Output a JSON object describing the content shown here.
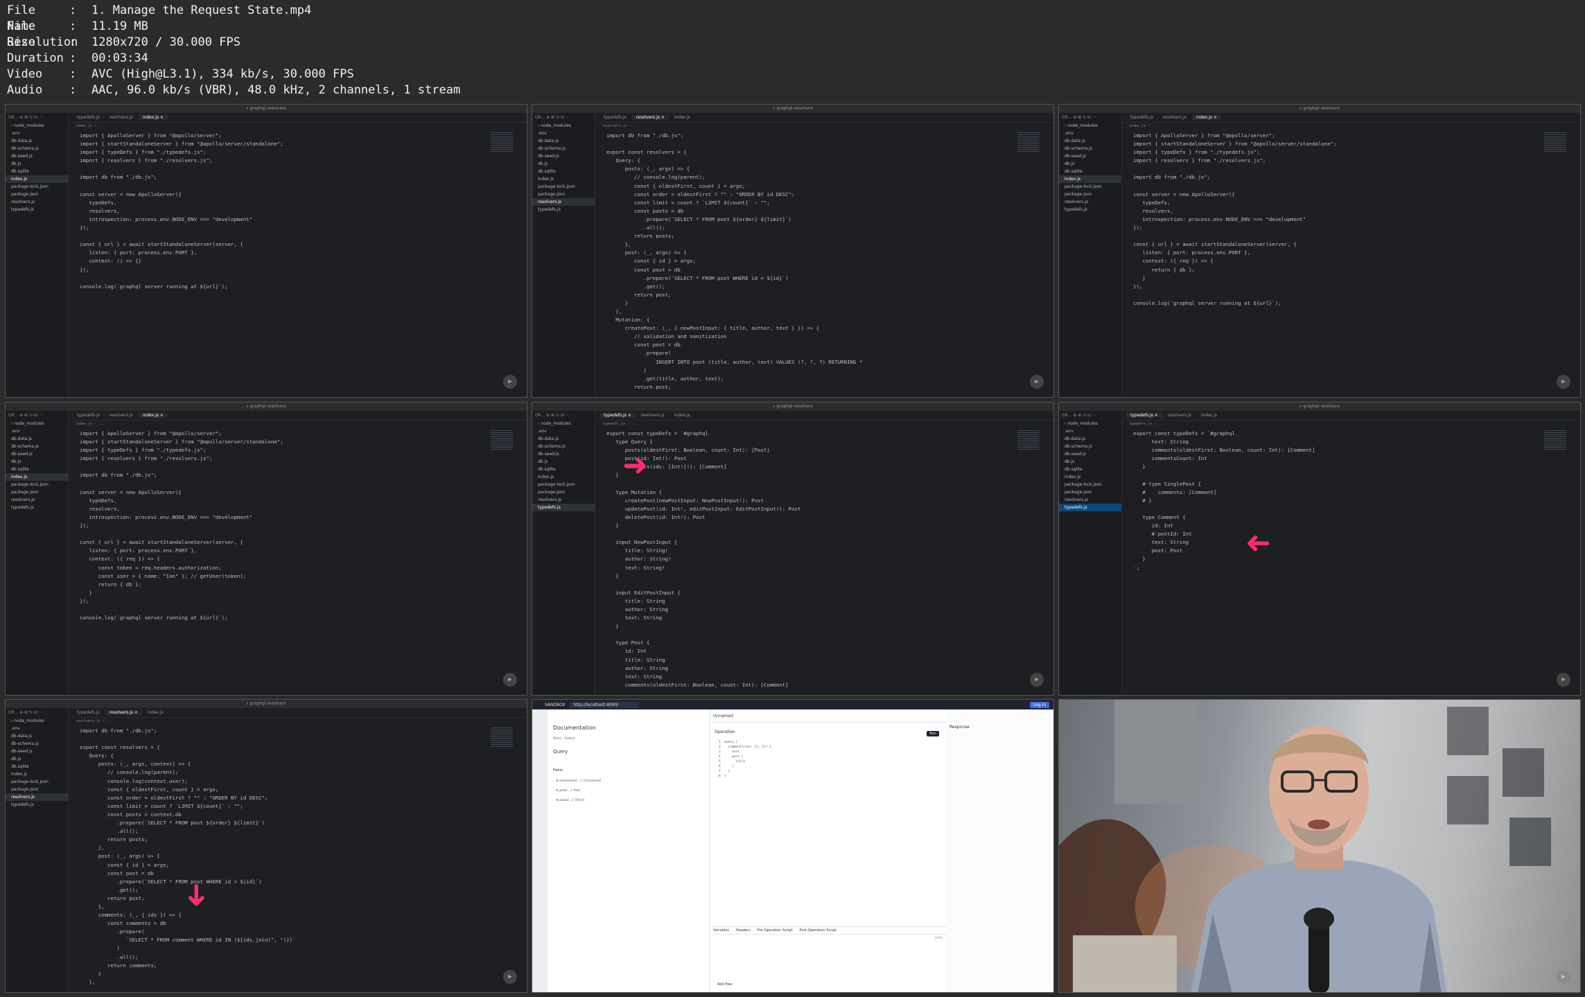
{
  "meta": [
    {
      "key": "File Name",
      "value": "1. Manage the Request State.mp4"
    },
    {
      "key": "File Size",
      "value": "11.19 MB"
    },
    {
      "key": "Resolution",
      "value": "1280x720 / 30.000 FPS"
    },
    {
      "key": "Duration",
      "value": "00:03:34"
    },
    {
      "key": "Video",
      "value": "AVC (High@L3.1), 334 kb/s, 30.000 FPS"
    },
    {
      "key": "Audio",
      "value": "AAC, 96.0 kb/s (VBR), 48.0 kHz, 2 channels, 1 stream"
    }
  ],
  "ide": {
    "window_title": "graphql-resolvers",
    "files": [
      "node_modules",
      ".env",
      "db-data.js",
      "db-schema.js",
      "db-seed.js",
      "db.js",
      "db.sqlite",
      "index.js",
      "package-lock.json",
      "package.json",
      "resolvers.js",
      "typedefs.js"
    ],
    "tabs": [
      "typedefs.js",
      "resolvers.js",
      "index.js"
    ]
  },
  "frames": [
    {
      "active_file": "index.js",
      "code": "import { ApolloServer } from \"@apollo/server\";\nimport { startStandaloneServer } from \"@apollo/server/standalone\";\nimport { typeDefs } from \"./typedefs.js\";\nimport { resolvers } from \"./resolvers.js\";\n\nimport db from \"./db.js\";\n\nconst server = new ApolloServer({\n   typeDefs,\n   resolvers,\n   introspection: process.env.NODE_ENV === \"development\"\n});\n\nconst { url } = await startStandaloneServer(server, {\n   listen: { port: process.env.PORT },\n   context: () => {}\n});\n\nconsole.log(`graphql server running at ${url}`);"
    },
    {
      "active_file": "resolvers.js",
      "code": "import db from \"./db.js\";\n\nexport const resolvers = {\n   Query: {\n      posts: (_, args) => {\n         // console.log(parent);\n         const { oldestFirst, count } = args;\n         const order = oldestFirst ? \"\" : \"ORDER BY id DESC\";\n         const limit = count ? `LIMIT ${count}` : \"\";\n         const posts = db\n            .prepare(`SELECT * FROM post ${order} ${limit}`)\n            .all();\n         return posts;\n      },\n      post: (_, args) => {\n         const { id } = args;\n         const post = db\n            .prepare(`SELECT * FROM post WHERE id = ${id}`)\n            .get();\n         return post;\n      }\n   },\n   Mutation: {\n      createPost: (_, { newPostInput: { title, author, text } }) => {\n         // validation and sanitization\n         const post = db\n            .prepare(\n               `INSERT INTO post (title, author, text) VALUES (?, ?, ?) RETURNING *`\n            )\n            .get(title, author, text);\n         return post;"
    },
    {
      "active_file": "index.js",
      "code": "import { ApolloServer } from \"@apollo/server\";\nimport { startStandaloneServer } from \"@apollo/server/standalone\";\nimport { typeDefs } from \"./typedefs.js\";\nimport { resolvers } from \"./resolvers.js\";\n\nimport db from \"./db.js\";\n\nconst server = new ApolloServer({\n   typeDefs,\n   resolvers,\n   introspection: process.env.NODE_ENV === \"development\"\n});\n\nconst { url } = await startStandaloneServer(server, {\n   listen: { port: process.env.PORT },\n   context: ({ req }) => {\n      return { db };\n   }\n});\n\nconsole.log(`graphql server running at ${url}`);"
    },
    {
      "active_file": "index.js",
      "code": "import { ApolloServer } from \"@apollo/server\";\nimport { startStandaloneServer } from \"@apollo/server/standalone\";\nimport { typeDefs } from \"./typedefs.js\";\nimport { resolvers } from \"./resolvers.js\";\n\nimport db from \"./db.js\";\n\nconst server = new ApolloServer({\n   typeDefs,\n   resolvers,\n   introspection: process.env.NODE_ENV === \"development\"\n});\n\nconst { url } = await startStandaloneServer(server, {\n   listen: { port: process.env.PORT },\n   context: ({ req }) => {\n      const token = req.headers.authorization;\n      const user = { name: \"Ian\" }; // getUser(token);\n      return { db };\n   }\n});\n\nconsole.log(`graphql server running at ${url}`);"
    },
    {
      "active_file": "typedefs.js",
      "code": "export const typeDefs = `#graphql\n   type Query {\n      posts(oldestFirst: Boolean, count: Int): [Post]\n      post(id: Int!): Post\n      comments(ids: [Int!]!): [Comment]\n   }\n\n   type Mutation {\n      createPost(newPostInput: NewPostInput!): Post\n      updatePost(id: Int!, editPostInput: EditPostInput!): Post\n      deletePost(id: Int!): Post\n   }\n\n   input NewPostInput {\n      title: String!\n      author: String!\n      text: String!\n   }\n\n   input EditPostInput {\n      title: String\n      author: String\n      text: String\n   }\n\n   type Post {\n      id: Int\n      title: String\n      author: String\n      text: String\n      comments(oldestFirst: Boolean, count: Int): [Comment]"
    },
    {
      "active_file": "typedefs.js",
      "code": "export const typeDefs = `#graphql\n      text: String\n      comments(oldestFirst: Boolean, count: Int): [Comment]\n      commentsCount: Int\n   }\n\n   # type SinglePost {\n   #    comments: [Comment]\n   # }\n\n   type Comment {\n      id: Int\n      # postId: Int\n      text: String\n      post: Post\n   }\n`;"
    },
    {
      "active_file": "resolvers.js",
      "code": "import db from \"./db.js\";\n\nexport const resolvers = {\n   Query: {\n      posts: (_, args, context) => {\n         // console.log(parent);\n         console.log(context.user);\n         const { oldestFirst, count } = args;\n         const order = oldestFirst ? \"\" : \"ORDER BY id DESC\";\n         const limit = count ? `LIMIT ${count}` : \"\";\n         const posts = context.db\n            .prepare(`SELECT * FROM post ${order} ${limit}`)\n            .all();\n         return posts;\n      },\n      post: (_, args) => {\n         const { id } = args;\n         const post = db\n            .prepare(`SELECT * FROM post WHERE id = ${id}`)\n            .get();\n         return post;\n      },\n      comments: (_, { ids }) => {\n         const comments = db\n            .prepare(\n               `SELECT * FROM comment WHERE id IN (${ids.join(\", \")})`\n            )\n            .all();\n         return comments;\n      }\n   },"
    }
  ],
  "sandbox": {
    "url": "http://localhost:4000/",
    "brand": "SANDBOX",
    "login": "Log in",
    "doc_title": "Documentation",
    "crumb": "Root › Query",
    "query_label": "Query",
    "fields_label": "Fields",
    "fields": [
      "comments(…): [Comment]",
      "post(…): Post",
      "posts(…): [Post]"
    ],
    "tab": "Unnamed",
    "operation_label": "Operation",
    "run": "Run",
    "response_label": "Response",
    "op_lines": [
      "1  query {",
      "2    comments(ids: [1, 2]) {",
      "3      text",
      "4      post {",
      "5        title",
      "6      }",
      "7    }",
      "8  }"
    ],
    "bottom_tabs": [
      "Variables",
      "Headers",
      "Pre-Operation Script",
      "Post-Operation Script"
    ],
    "json_label": "JSON",
    "add_files": "Add files"
  }
}
